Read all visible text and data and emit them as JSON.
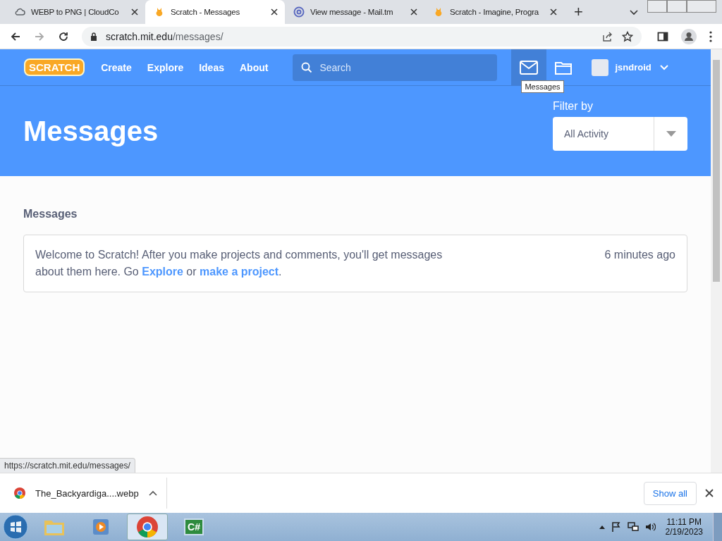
{
  "browser": {
    "tabs": [
      {
        "title": "WEBP to PNG | CloudCo",
        "kind": "cloud",
        "selected": false
      },
      {
        "title": "Scratch - Messages",
        "kind": "scratch",
        "selected": true
      },
      {
        "title": "View message - Mail.tm",
        "kind": "mail",
        "selected": false
      },
      {
        "title": "Scratch - Imagine, Progra",
        "kind": "scratch",
        "selected": false
      }
    ],
    "new_tab": "+",
    "address": {
      "host": "scratch.mit.edu",
      "path": "/messages/"
    }
  },
  "nav": {
    "logo": "SCRATCH",
    "links": [
      "Create",
      "Explore",
      "Ideas",
      "About"
    ],
    "search": {
      "placeholder": "Search"
    },
    "username": "jsndroid",
    "tooltip": "Messages"
  },
  "hero": {
    "title": "Messages",
    "filter_label": "Filter by",
    "filter_value": "All Activity"
  },
  "section_title": "Messages",
  "messages": [
    {
      "parts": [
        {
          "kind": "text",
          "text": "Welcome to Scratch! After you make projects and comments, you'll get messages about them here. Go "
        },
        {
          "kind": "link",
          "text": "Explore"
        },
        {
          "kind": "text",
          "text": " or "
        },
        {
          "kind": "link",
          "text": "make a project"
        },
        {
          "kind": "text",
          "text": "."
        }
      ],
      "time": "6 minutes ago"
    }
  ],
  "status_url": "https://scratch.mit.edu/messages/",
  "downloads": [
    {
      "file": "The_Backyardiga....webp"
    }
  ],
  "show_all": "Show all",
  "taskbar": {
    "apps": [
      {
        "kind": "explorer",
        "selected": false
      },
      {
        "kind": "media",
        "selected": false
      },
      {
        "kind": "chrome",
        "selected": true
      },
      {
        "kind": "csharp",
        "label": "C#",
        "selected": false
      }
    ],
    "time": "11:11 PM",
    "date": "2/19/2023"
  }
}
